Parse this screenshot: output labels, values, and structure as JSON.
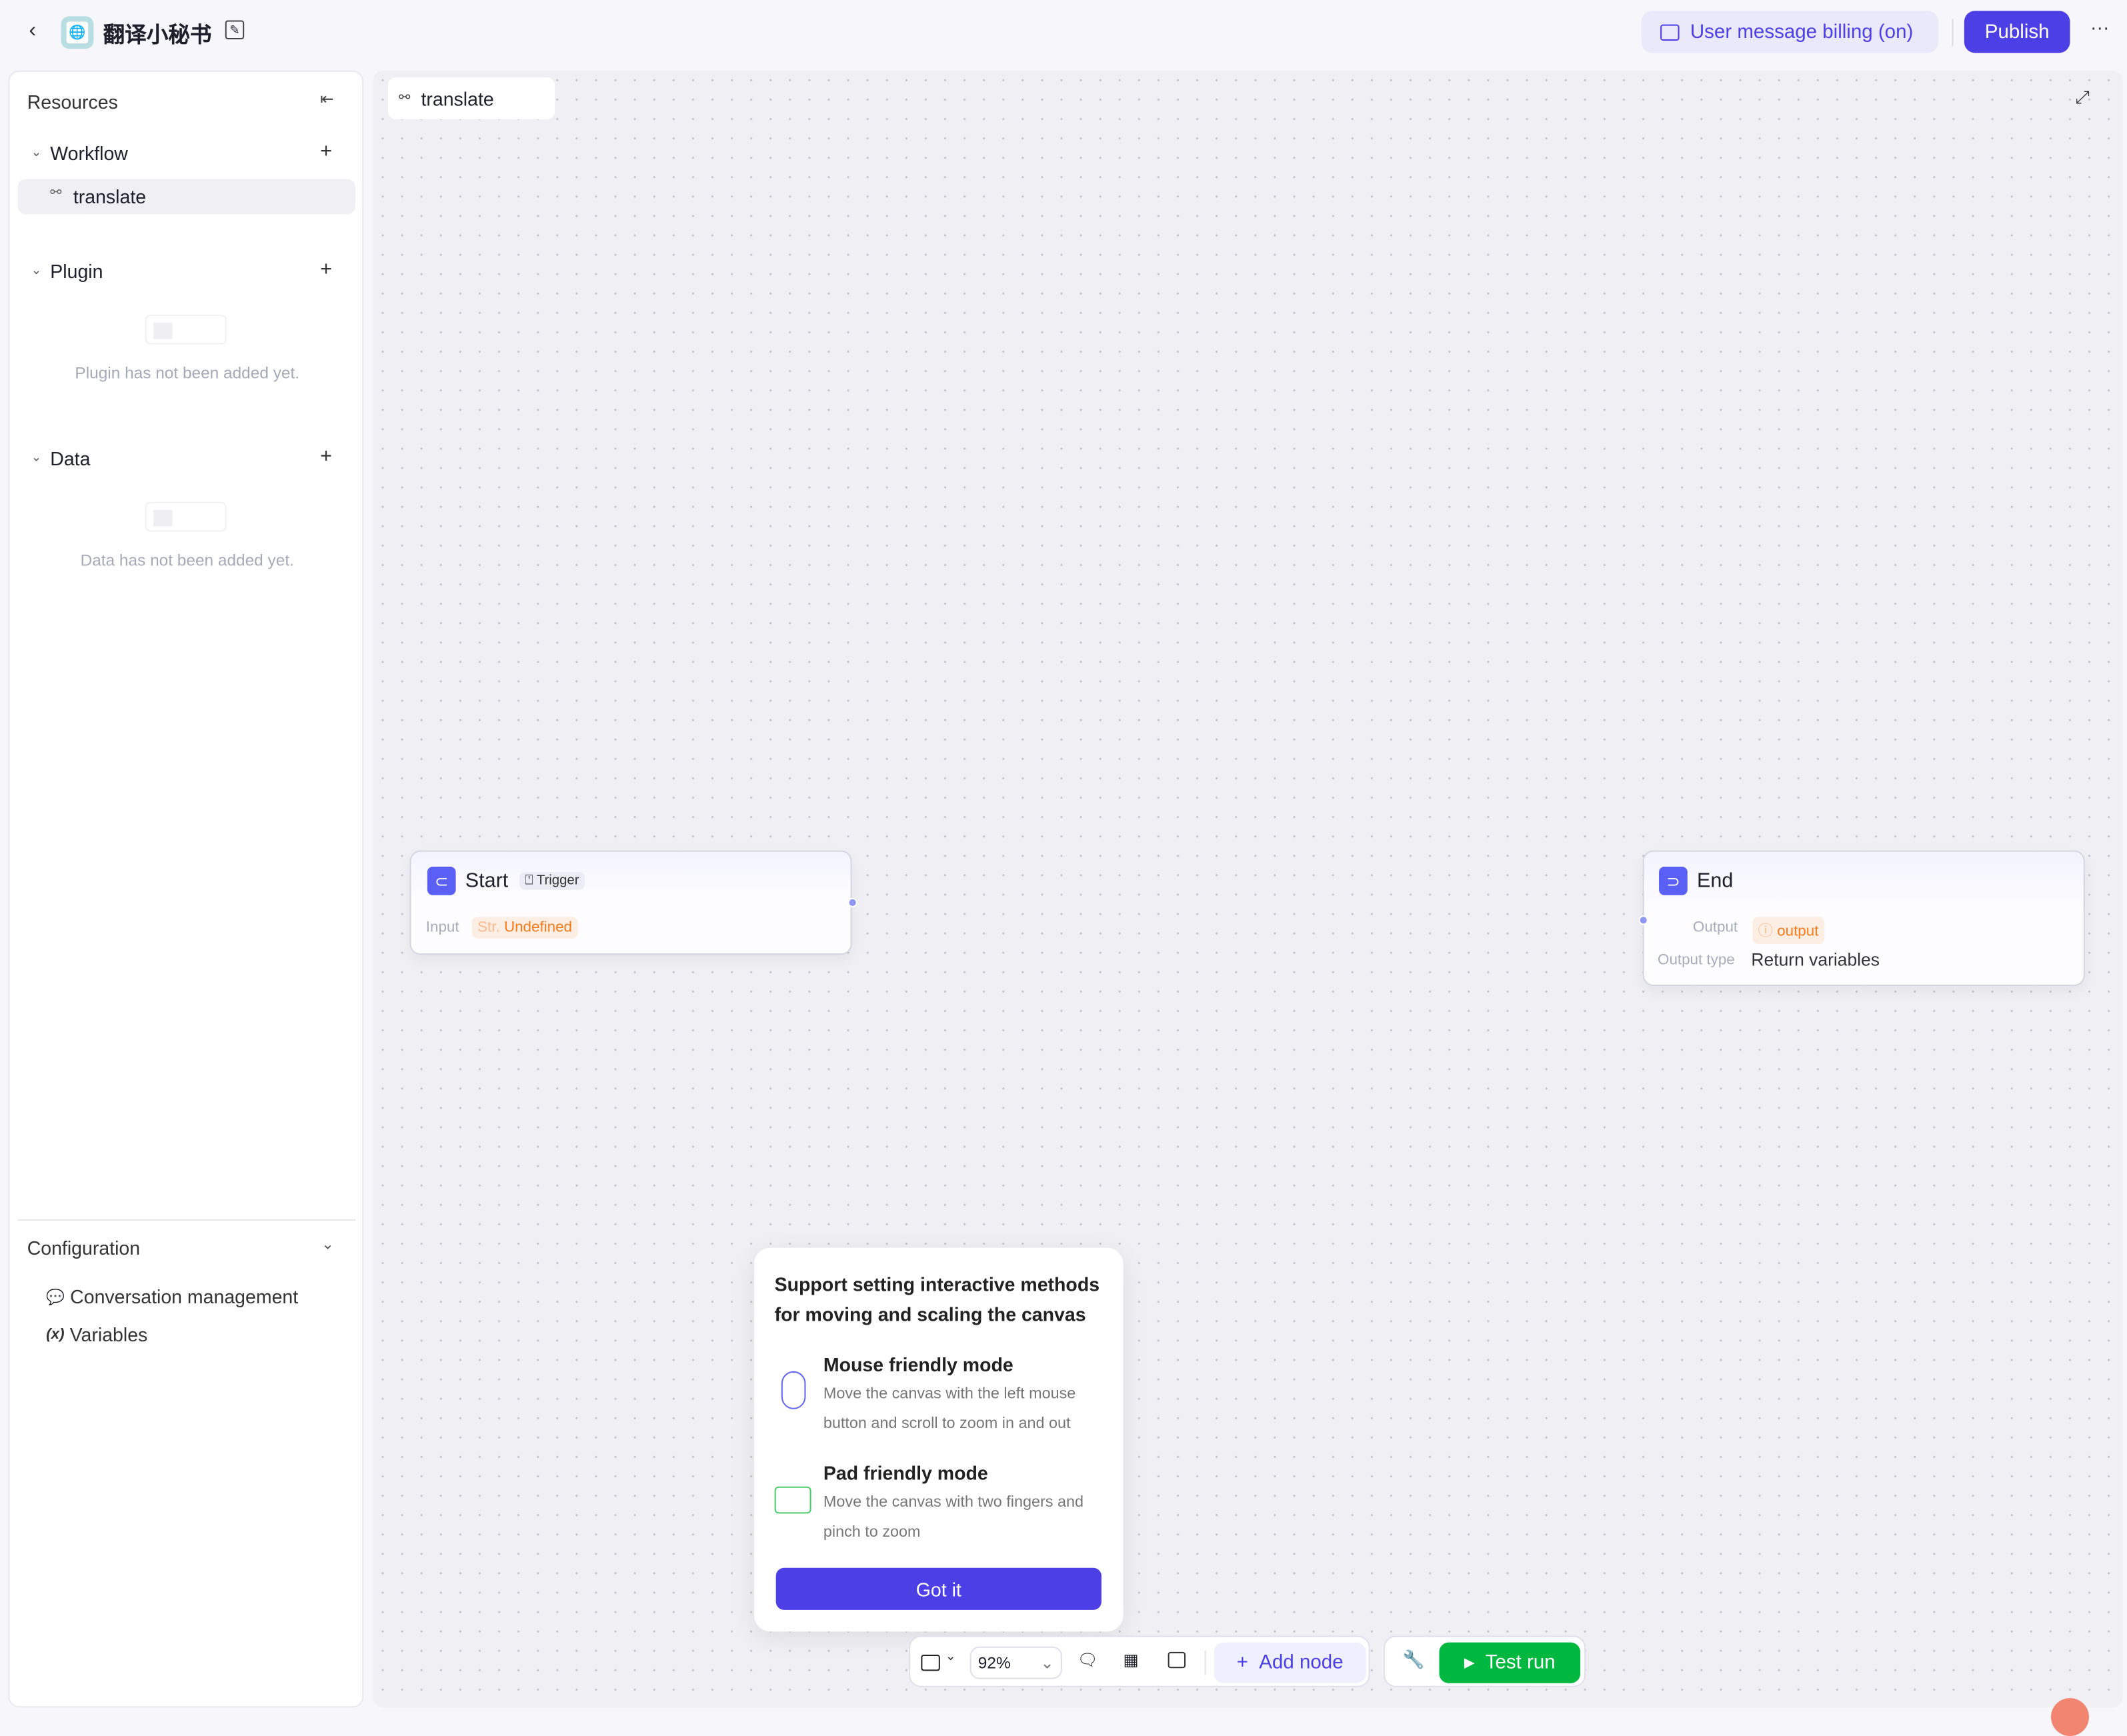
{
  "header": {
    "title": "翻译小秘书",
    "billing_label": "User message billing (on)",
    "publish_label": "Publish"
  },
  "sidebar": {
    "title": "Resources",
    "workflow": {
      "label": "Workflow",
      "items": [
        {
          "label": "translate"
        }
      ]
    },
    "plugin": {
      "label": "Plugin",
      "empty": "Plugin has not been added yet."
    },
    "data": {
      "label": "Data",
      "empty": "Data has not been added yet."
    },
    "configuration": {
      "label": "Configuration",
      "items": [
        {
          "label": "Conversation management",
          "icon": "chat-gear-icon"
        },
        {
          "label": "Variables",
          "icon": "variable-x-icon"
        }
      ]
    }
  },
  "canvas": {
    "tab_label": "translate",
    "start_node": {
      "title": "Start",
      "badge": "Trigger",
      "input_label": "Input",
      "input_type": "Str.",
      "input_value": "Undefined"
    },
    "end_node": {
      "title": "End",
      "output_label": "Output",
      "output_value": "output",
      "output_type_label": "Output type",
      "output_type_value": "Return variables"
    }
  },
  "popover": {
    "title": "Support setting interactive methods for moving and scaling the canvas",
    "mouse_title": "Mouse friendly mode",
    "mouse_desc": "Move the canvas with the left mouse button and scroll to zoom in and out",
    "pad_title": "Pad friendly mode",
    "pad_desc": "Move the canvas with two fingers and pinch to zoom",
    "confirm_label": "Got it"
  },
  "toolbar": {
    "zoom": "92%",
    "add_node_label": "Add node",
    "test_run_label": "Test run"
  },
  "colors": {
    "accent": "#4d3fe6",
    "green": "#00b83f",
    "orange": "#f57a1c",
    "node_icon": "#5a60f5"
  }
}
